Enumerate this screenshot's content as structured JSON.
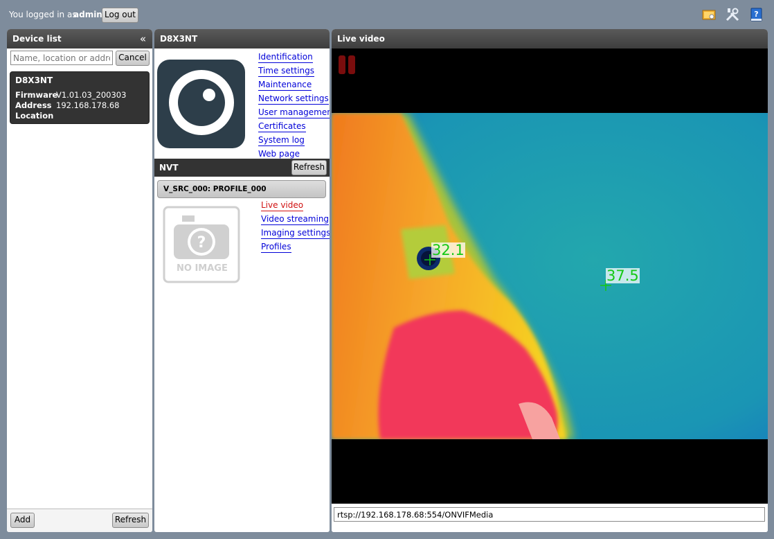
{
  "topbar": {
    "login_text": "You logged in as",
    "username": "admin",
    "logout_label": "Log out",
    "icons": [
      "wallpaper-icon",
      "tools-icon",
      "help-book-icon"
    ]
  },
  "device_list": {
    "title": "Device list",
    "search_placeholder": "Name, location or address",
    "cancel_label": "Cancel",
    "devices": [
      {
        "name": "D8X3NT",
        "firmware_label": "Firmware",
        "firmware": "V1.01.03_200303",
        "address_label": "Address",
        "address": "192.168.178.68",
        "location_label": "Location",
        "location": ""
      }
    ],
    "add_label": "Add",
    "refresh_label": "Refresh"
  },
  "device_info": {
    "title": "D8X3NT",
    "menu": [
      "Identification",
      "Time settings",
      "Maintenance",
      "Network settings",
      "User management",
      "Certificates",
      "System log",
      "Web page"
    ],
    "nvt_title": "NVT",
    "nvt_refresh_label": "Refresh",
    "profile_label": "V_SRC_000: PROFILE_000",
    "no_image_text": "NO IMAGE",
    "profile_links": [
      "Live video",
      "Video streaming",
      "Imaging settings",
      "Profiles"
    ],
    "active_link": "Live video"
  },
  "live_video": {
    "title": "Live video",
    "stream_url": "rtsp://192.168.178.68:554/ONVIFMedia",
    "temperatures": [
      {
        "label": "32.1"
      },
      {
        "label": "37.5"
      }
    ],
    "colors": {
      "background_tone": "#1a9aa8",
      "hot": "#f23a5a",
      "warm": "#f5c418",
      "marker": "#14c814"
    }
  }
}
